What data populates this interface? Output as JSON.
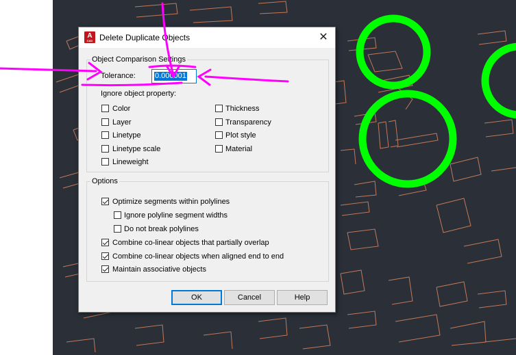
{
  "dialog": {
    "title": "Delete Duplicate Objects",
    "app_icon_letter": "A",
    "app_icon_sub": "CAD",
    "close_glyph": "✕"
  },
  "comparison": {
    "group_label": "Object Comparison Settings",
    "tolerance_label": "Tolerance:",
    "tolerance_value": "0.000001",
    "ignore_label": "Ignore object property:",
    "props": [
      {
        "label": "Color",
        "checked": false
      },
      {
        "label": "Layer",
        "checked": false
      },
      {
        "label": "Linetype",
        "checked": false
      },
      {
        "label": "Linetype scale",
        "checked": false
      },
      {
        "label": "Lineweight",
        "checked": false
      },
      {
        "label": "Thickness",
        "checked": false
      },
      {
        "label": "Transparency",
        "checked": false
      },
      {
        "label": "Plot style",
        "checked": false
      },
      {
        "label": "Material",
        "checked": false
      }
    ]
  },
  "options": {
    "group_label": "Options",
    "items": [
      {
        "label": "Optimize segments within polylines",
        "checked": true
      },
      {
        "label": "Ignore polyline segment widths",
        "checked": false
      },
      {
        "label": "Do not break polylines",
        "checked": false
      },
      {
        "label": "Combine co-linear objects that partially overlap",
        "checked": true
      },
      {
        "label": "Combine co-linear objects when aligned end to end",
        "checked": true
      },
      {
        "label": "Maintain associative objects",
        "checked": true
      }
    ]
  },
  "buttons": {
    "ok": "OK",
    "cancel": "Cancel",
    "help": "Help"
  },
  "colors": {
    "cad_background": "#2a2f38",
    "cad_lines": "#c57a58",
    "annotation_magenta": "#ff00ff",
    "annotation_green": "#00ff00",
    "accent_blue": "#0078d7"
  }
}
